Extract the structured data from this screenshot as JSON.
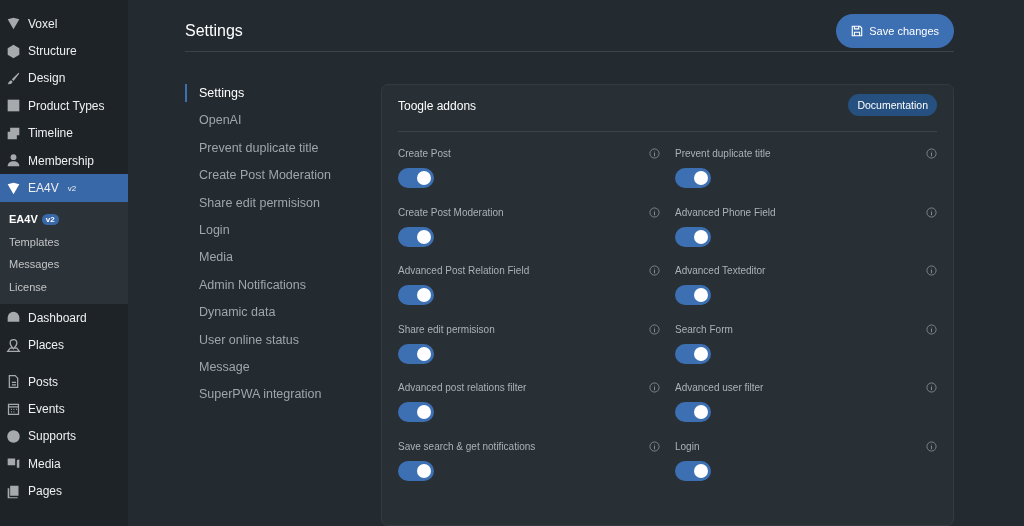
{
  "sidebar": {
    "groups": [
      {
        "items": [
          {
            "label": "Voxel",
            "selected": false
          },
          {
            "label": "Structure",
            "selected": false
          },
          {
            "label": "Design",
            "selected": false
          },
          {
            "label": "Product Types",
            "selected": false
          },
          {
            "label": "Timeline",
            "selected": false
          },
          {
            "label": "Membership",
            "selected": false
          },
          {
            "label": "EA4V",
            "badge": "v2",
            "selected": true,
            "submenu": [
              {
                "label": "EA4V",
                "badge": "v2",
                "selected": true
              },
              {
                "label": "Templates",
                "selected": false
              },
              {
                "label": "Messages",
                "selected": false
              },
              {
                "label": "License",
                "selected": false
              }
            ]
          },
          {
            "label": "Dashboard",
            "selected": false
          },
          {
            "label": "Places",
            "selected": false
          }
        ]
      },
      {
        "items": [
          {
            "label": "Posts",
            "selected": false
          },
          {
            "label": "Events",
            "selected": false
          },
          {
            "label": "Supports",
            "selected": false
          },
          {
            "label": "Media",
            "selected": false
          },
          {
            "label": "Pages",
            "selected": false
          }
        ]
      }
    ]
  },
  "header": {
    "title": "Settings",
    "save_button": "Save changes"
  },
  "settings_nav": [
    {
      "label": "Settings",
      "selected": true
    },
    {
      "label": "OpenAI",
      "selected": false
    },
    {
      "label": "Prevent duplicate title",
      "selected": false
    },
    {
      "label": "Create Post Moderation",
      "selected": false
    },
    {
      "label": "Share edit permisison",
      "selected": false
    },
    {
      "label": "Login",
      "selected": false
    },
    {
      "label": "Media",
      "selected": false
    },
    {
      "label": "Admin Notifications",
      "selected": false
    },
    {
      "label": "Dynamic data",
      "selected": false
    },
    {
      "label": "User online status",
      "selected": false
    },
    {
      "label": "Message",
      "selected": false
    },
    {
      "label": "SuperPWA integration",
      "selected": false
    }
  ],
  "card": {
    "title": "Toogle addons",
    "doc_button": "Documentation",
    "addons": [
      {
        "label": "Create Post",
        "on": true
      },
      {
        "label": "Prevent duplicate title",
        "on": true
      },
      {
        "label": "Create Post Moderation",
        "on": true
      },
      {
        "label": "Advanced Phone Field",
        "on": true
      },
      {
        "label": "Advanced Post Relation Field",
        "on": true
      },
      {
        "label": "Advanced Texteditor",
        "on": true
      },
      {
        "label": "Share edit permisison",
        "on": true
      },
      {
        "label": "Search Form",
        "on": true
      },
      {
        "label": "Advanced post relations filter",
        "on": true
      },
      {
        "label": "Advanced user filter",
        "on": true
      },
      {
        "label": "Save search & get notifications",
        "on": true
      },
      {
        "label": "Login",
        "on": true
      }
    ]
  }
}
